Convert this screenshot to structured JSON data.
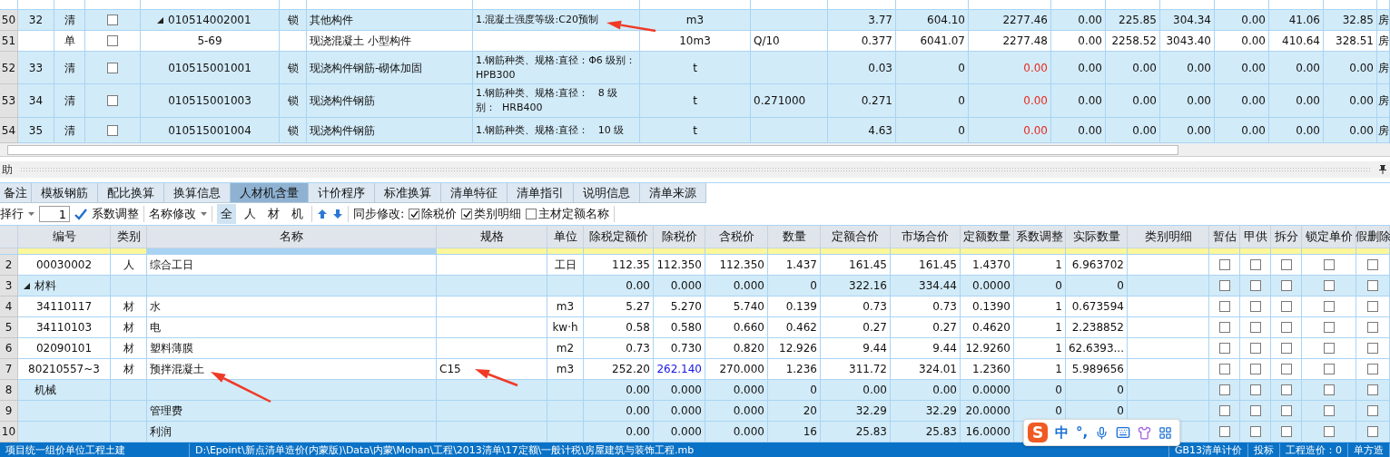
{
  "top_grid": {
    "rows": [
      {
        "no": "50",
        "seq": "32",
        "type": "清",
        "kind": "bill",
        "checked": false,
        "expanded": true,
        "code": "010514002001",
        "lock": "锁",
        "name": "其他构件",
        "feature": "1.混凝土强度等级:C20预制",
        "unit": "m3",
        "qty": "3.77",
        "values": [
          "604.10",
          "2277.46",
          "0.00",
          "225.85",
          "304.34",
          "0.00",
          "41.06",
          "32.85"
        ],
        "price_alert": false,
        "tail": "房"
      },
      {
        "no": "51",
        "type": "单",
        "kind": "quota",
        "checked": false,
        "code": "5-69",
        "name": "现浇混凝土 小型构件",
        "unit": "10m3",
        "q": "Q/10",
        "qty": "0.377",
        "values": [
          "6041.07",
          "2277.48",
          "0.00",
          "2258.52",
          "3043.40",
          "0.00",
          "410.64",
          "328.51"
        ],
        "price_alert": false,
        "tail": "房"
      },
      {
        "no": "52",
        "seq": "33",
        "type": "清",
        "kind": "bill",
        "checked": false,
        "code": "010515001001",
        "lock": "锁",
        "name": "现浇构件钢筋-砌体加固",
        "feature": "1.钢筋种类、规格:直径：Φ6 级别：HPB300",
        "unit": "t",
        "qty": "0.03",
        "values": [
          "0",
          "0.00",
          "0.00",
          "0.00",
          "0.00",
          "0.00",
          "0.00",
          "0.00"
        ],
        "price_alert": true,
        "tail": "房"
      },
      {
        "no": "53",
        "seq": "34",
        "type": "清",
        "kind": "bill",
        "checked": false,
        "code": "010515001003",
        "lock": "锁",
        "name": "现浇构件钢筋",
        "feature": "1.钢筋种类、规格:直径：   8 级别：  HRB400",
        "unit": "t",
        "q": "0.271000",
        "qty": "0.271",
        "values": [
          "0",
          "0.00",
          "0.00",
          "0.00",
          "0.00",
          "0.00",
          "0.00",
          "0.00"
        ],
        "price_alert": true,
        "tail": "房"
      },
      {
        "no": "54",
        "seq": "35",
        "type": "清",
        "kind": "bill",
        "checked": false,
        "code": "010515001004",
        "lock": "锁",
        "name": "现浇构件钢筋",
        "feature": "1.钢筋种类、规格:直径：   10 级",
        "unit": "t",
        "qty": "4.63",
        "values": [
          "0",
          "0.00",
          "0.00",
          "0.00",
          "0.00",
          "0.00",
          "0.00",
          "0.00"
        ],
        "price_alert": true,
        "tail": "房"
      }
    ]
  },
  "panel_title": "助",
  "tabs": [
    {
      "label": "备注",
      "selected": false
    },
    {
      "label": "模板钢筋",
      "selected": false
    },
    {
      "label": "配比换算",
      "selected": false
    },
    {
      "label": "换算信息",
      "selected": false
    },
    {
      "label": "人材机含量",
      "selected": true
    },
    {
      "label": "计价程序",
      "selected": false
    },
    {
      "label": "标准换算",
      "selected": false
    },
    {
      "label": "清单特征",
      "selected": false
    },
    {
      "label": "清单指引",
      "selected": false
    },
    {
      "label": "说明信息",
      "selected": false
    },
    {
      "label": "清单来源",
      "selected": false
    }
  ],
  "toolbar": {
    "row_select": "择行",
    "row_count": "1",
    "coef_adjust": "系数调整",
    "rename": "名称修改",
    "filters": [
      {
        "label": "全",
        "selected": true
      },
      {
        "label": "人",
        "selected": false
      },
      {
        "label": "材",
        "selected": false
      },
      {
        "label": "机",
        "selected": false
      }
    ],
    "sync_label": "同步修改:",
    "sync_options": [
      {
        "label": "除税价",
        "checked": true
      },
      {
        "label": "类别明细",
        "checked": true
      },
      {
        "label": "主材定额名称",
        "checked": false
      }
    ]
  },
  "bottom_grid": {
    "columns": [
      "编号",
      "类别",
      "名称",
      "规格",
      "单位",
      "除税定额价",
      "除税价",
      "含税价",
      "数量",
      "定额合价",
      "市场合价",
      "定额数量",
      "系数调整",
      "实际数量",
      "类别明细",
      "暂估",
      "甲供",
      "拆分",
      "锁定单价",
      "假删除"
    ],
    "rows": [
      {
        "no": "2",
        "kind": "item",
        "code": "00030002",
        "cat": "人",
        "name": "综合工日",
        "unit": "工日",
        "values": [
          "112.35",
          "112.350",
          "112.350",
          "1.437",
          "161.45",
          "161.45",
          "1.4370",
          "1",
          "6.963702"
        ],
        "price_modified": false,
        "flags": [
          false,
          false,
          false,
          false,
          false
        ]
      },
      {
        "no": "3",
        "kind": "group",
        "expanded": true,
        "code": "材料",
        "values": [
          "0.00",
          "0.000",
          "0.000",
          "0",
          "322.16",
          "334.44",
          "0.0000",
          "0",
          "0"
        ],
        "flags": [
          false,
          false,
          false,
          false,
          false
        ]
      },
      {
        "no": "4",
        "kind": "item",
        "code": "34110117",
        "cat": "材",
        "name": "水",
        "unit": "m3",
        "values": [
          "5.27",
          "5.270",
          "5.740",
          "0.139",
          "0.73",
          "0.73",
          "0.1390",
          "1",
          "0.673594"
        ],
        "price_modified": false,
        "flags": [
          false,
          false,
          false,
          false,
          false
        ]
      },
      {
        "no": "5",
        "kind": "item",
        "code": "34110103",
        "cat": "材",
        "name": "电",
        "unit": "kw·h",
        "values": [
          "0.58",
          "0.580",
          "0.660",
          "0.462",
          "0.27",
          "0.27",
          "0.4620",
          "1",
          "2.238852"
        ],
        "price_modified": false,
        "flags": [
          false,
          false,
          false,
          false,
          false
        ]
      },
      {
        "no": "6",
        "kind": "item",
        "code": "02090101",
        "cat": "材",
        "name": "塑料薄膜",
        "unit": "m2",
        "values": [
          "0.73",
          "0.730",
          "0.820",
          "12.926",
          "9.44",
          "9.44",
          "12.9260",
          "1",
          "62.6393..."
        ],
        "price_modified": false,
        "flags": [
          false,
          false,
          false,
          false,
          false
        ]
      },
      {
        "no": "7",
        "kind": "item",
        "code": "80210557~3",
        "cat": "材",
        "name": "预拌混凝土",
        "spec": "C15",
        "unit": "m3",
        "values": [
          "252.20",
          "262.140",
          "270.000",
          "1.236",
          "311.72",
          "324.01",
          "1.2360",
          "1",
          "5.989656"
        ],
        "price_modified": true,
        "flags": [
          false,
          false,
          false,
          false,
          false
        ]
      },
      {
        "no": "8",
        "kind": "group",
        "code": "机械",
        "values": [
          "0.00",
          "0.000",
          "0.000",
          "0",
          "0.00",
          "0.00",
          "0.0000",
          "0",
          "0"
        ],
        "flags": [
          false,
          false,
          false,
          false,
          false
        ]
      },
      {
        "no": "9",
        "kind": "group",
        "name": "管理费",
        "values": [
          "0.00",
          "0.000",
          "0.000",
          "20",
          "32.29",
          "32.29",
          "20.0000",
          "0",
          "0"
        ],
        "flags": [
          false,
          false,
          false,
          false,
          false
        ]
      },
      {
        "no": "10",
        "kind": "group",
        "name": "利润",
        "values": [
          "0.00",
          "0.000",
          "0.000",
          "16",
          "25.83",
          "25.83",
          "16.0000"
        ],
        "flags": [
          false,
          false,
          false,
          false,
          false
        ]
      }
    ]
  },
  "ime": {
    "logo": "S",
    "mode": "中",
    "punct": "°,"
  },
  "status_bar": {
    "project": "项目统一组价单位工程土建",
    "path": "D:\\Epoint\\新点清单造价(内蒙版)\\Data\\内蒙\\Mohan\\工程\\2013清单\\17定额\\一般计税\\房屋建筑与装饰工程.mb",
    "items": [
      "GB13清单计价",
      "投标",
      "工程造价：0",
      "单方造"
    ]
  }
}
